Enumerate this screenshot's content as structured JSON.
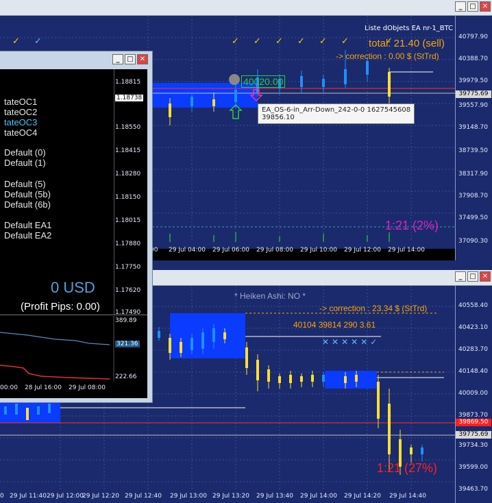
{
  "top_window": {
    "ea_label": "Liste dObjets EA nr-1_BTC",
    "total": "total: 21.40 (sell)",
    "correction": "-> correction : 0.00 $ (StTrd)",
    "ratio": "1:21 (2%)",
    "entry_price": "40020.00",
    "tooltip_line1": "EA_OS-6-in_Arr-Down_242-0-0 1627545608",
    "tooltip_line2": "39856.10",
    "price_labels": [
      "40797.90",
      "40388.70",
      "39979.50",
      "39557.90",
      "39148.70",
      "38739.50",
      "38317.90",
      "37908.70",
      "37499.50",
      "37090.30"
    ],
    "bid_tag": "39775.69",
    "time_labels": [
      "29 Jul 04:00",
      "29 Jul 06:00",
      "29 Jul 08:00",
      "29 Jul 10:00",
      "29 Jul 12:00",
      "29 Jul 14:00"
    ],
    "first_time": ":00"
  },
  "bottom_window": {
    "heiken": "* Heiken Ashi: NO *",
    "correction": "-> correction : 23.34 $ (StTrd)",
    "levels_line": "40104 39814 290 3.61",
    "ratio": "1:21 (27%)",
    "price_labels": [
      "40558.40",
      "40423.10",
      "40283.70",
      "40148.40",
      "40009.00",
      "39873.70",
      "39734.30",
      "39599.00",
      "39463.70"
    ],
    "red_tag": "39869.50",
    "bid_tag": "39775.69",
    "time_labels": [
      "29 Jul 11:40",
      "29 Jul 12:00",
      "29 Jul 12:20",
      "29 Jul 12:40",
      "29 Jul 13:00",
      "29 Jul 13:20",
      "29 Jul 13:40",
      "29 Jul 14:00",
      "29 Jul 14:20",
      "29 Jul 14:40"
    ],
    "first_time": "0"
  },
  "dialog": {
    "items": [
      "tateOC1",
      "tateOC2",
      "tateOC3",
      "tateOC4",
      "Default (0)",
      "Default (1)",
      "Default (5)",
      "Default (5b)",
      "Default (6b)",
      "Default EA1",
      "Default EA2"
    ],
    "price_labels": [
      "1.18815",
      "1.18738",
      "1.18550",
      "1.18415",
      "1.18280",
      "1.18150",
      "1.18015",
      "1.17880",
      "1.17750",
      "1.17620",
      "1.17490"
    ],
    "usd": "0 USD",
    "profit_pips": "(Profit Pips: 0.00)",
    "mini_labels": [
      "389.89",
      "321.36",
      "222.66"
    ],
    "mini_times": [
      "00:00",
      "28 Jul 16:00",
      "29 Jul 08:00"
    ]
  },
  "colors": {
    "chart_bg": "#1a2a6c",
    "bull": "#1e90ff",
    "bear": "#ffe030",
    "ratio_top": "#e020c0",
    "ratio_bottom": "#ff2020",
    "accent": "#ffa500"
  }
}
